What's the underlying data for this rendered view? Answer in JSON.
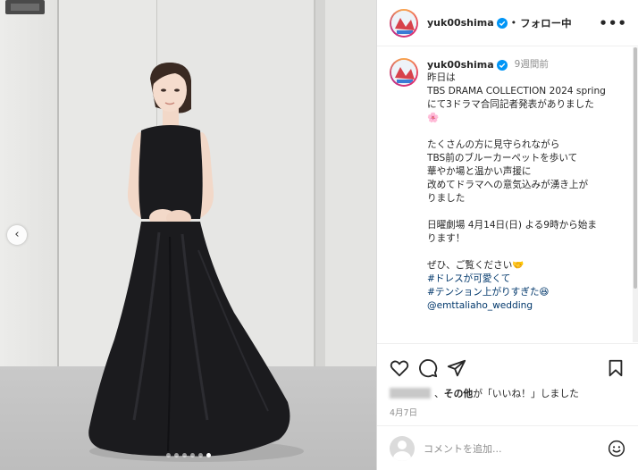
{
  "post": {
    "username": "yuk00shima",
    "follow_status": "フォロー中",
    "separator": "•",
    "more_menu": "•••",
    "caption": {
      "time_ago": "9週間前",
      "lines": [
        "昨日は",
        "TBS DRAMA COLLECTION 2024 spring",
        "にて3ドラマ合同記者発表がありました",
        "🌸",
        "",
        "たくさんの方に見守られながら",
        "TBS前のブルーカーペットを歩いて",
        "華やか場と温かい声援に",
        "改めてドラマへの意気込みが湧き上が",
        "りました",
        "",
        "日曜劇場 4月14日(日) よる9時から始ま",
        "ります！",
        "",
        "ぜひ、ご覧ください🤝"
      ],
      "hashtags": [
        "#ドレスが可愛くて",
        "#テンション上がりすぎた😆",
        "@emttaliaho_wedding"
      ]
    },
    "likes": {
      "prefix": "、",
      "others": "その他",
      "suffix": "が「いいね！」しました"
    },
    "date": "4月7日",
    "comment_placeholder": "コメントを追加...",
    "carousel": {
      "dot_count": 6,
      "active_index": 5
    }
  },
  "icons": {
    "prev": "chevron-left-icon",
    "like": "heart-icon",
    "comment": "comment-icon",
    "share": "share-icon",
    "save": "bookmark-icon",
    "emoji": "emoji-icon",
    "verified": "verified-badge-icon"
  },
  "colors": {
    "verified": "#0095f6",
    "link": "#00376b",
    "muted": "#8e8e8e",
    "dress": "#1b1b1e"
  }
}
